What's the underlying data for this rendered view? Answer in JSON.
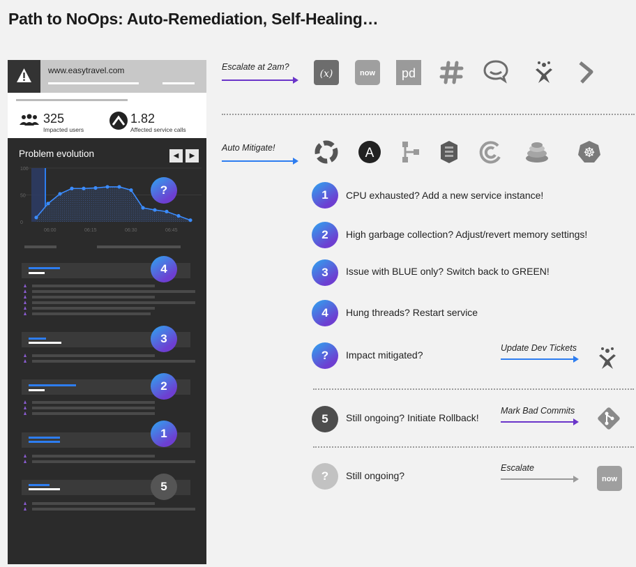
{
  "title": "Path to NoOps: Auto-Remediation, Self-Healing…",
  "problem_card": {
    "url": "www.easytravel.com",
    "impacted_users_value": "325",
    "impacted_users_label": "Impacted users",
    "service_calls_value": "1.82",
    "service_calls_label": "Affected service calls",
    "evolution_title": "Problem evolution",
    "prev_glyph": "◀",
    "next_glyph": "▶",
    "y_ticks": [
      "100",
      "50",
      "0"
    ],
    "x_ticks": [
      "06:00",
      "06:15",
      "06:30",
      "06:45"
    ],
    "chart_badge": "?",
    "event_badges": [
      "4",
      "3",
      "2",
      "1",
      "5"
    ]
  },
  "chart_data": {
    "type": "line",
    "ylim": [
      0,
      100
    ],
    "values": [
      8,
      34,
      52,
      62,
      62,
      63,
      65,
      65,
      59,
      26,
      22,
      19,
      11,
      3
    ]
  },
  "escalate": {
    "label": "Escalate at 2am?",
    "icons": [
      "xmatters-icon",
      "servicenow-icon",
      "pagerduty-icon",
      "slack-icon",
      "hipchat-icon",
      "jira-icon",
      "victorops-icon"
    ],
    "icon_texts": [
      "(x)",
      "now",
      "pd"
    ]
  },
  "mitigate": {
    "label": "Auto Mitigate!",
    "icons": [
      "stackstorm-icon",
      "ansible-icon",
      "graph-icon",
      "aws-icon",
      "cloudcheck-icon",
      "server-stack-icon",
      "kubernetes-icon"
    ],
    "ansible_letter": "A",
    "kubernetes_glyph": "☸"
  },
  "steps": [
    {
      "badge": "1",
      "text": "CPU exhausted? Add a new service instance!"
    },
    {
      "badge": "2",
      "text": "High garbage collection? Adjust/revert memory settings!"
    },
    {
      "badge": "3",
      "text": "Issue with BLUE only? Switch back to GREEN!"
    },
    {
      "badge": "4",
      "text": "Hung threads? Restart service"
    },
    {
      "badge": "?",
      "text": "Impact mitigated?",
      "action": "Update Dev Tickets",
      "icon": "jira-icon"
    },
    {
      "badge": "5",
      "text": "Still ongoing? Initiate Rollback!",
      "action": "Mark Bad Commits",
      "icon": "git-icon"
    },
    {
      "badge": "?",
      "text": "Still ongoing?",
      "action": "Escalate",
      "icon": "servicenow-icon",
      "icon_text": "now"
    }
  ],
  "colors": {
    "purple": "#6a35c9",
    "blue": "#2d7df0",
    "panel": "#2b2b2b",
    "grey_arrow": "#9a9a9a"
  }
}
